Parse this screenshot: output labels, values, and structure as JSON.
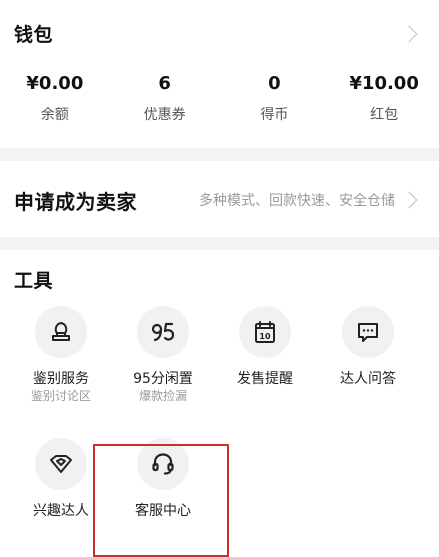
{
  "wallet": {
    "title": "钱包",
    "stats": [
      {
        "value": "¥0.00",
        "label": "余额"
      },
      {
        "value": "6",
        "label": "优惠券"
      },
      {
        "value": "0",
        "label": "得币"
      },
      {
        "value": "¥10.00",
        "label": "红包"
      }
    ]
  },
  "seller": {
    "title": "申请成为卖家",
    "description": "多种模式、回款快速、安全仓储"
  },
  "tools": {
    "title": "工具",
    "items": [
      {
        "label": "鉴别服务",
        "sub": "鉴别讨论区",
        "icon": "stamp-icon"
      },
      {
        "label": "95分闲置",
        "sub": "爆款捡漏",
        "icon": "95-logo-icon"
      },
      {
        "label": "发售提醒",
        "sub": "",
        "icon": "calendar-icon"
      },
      {
        "label": "达人问答",
        "sub": "",
        "icon": "chat-bubble-icon"
      },
      {
        "label": "兴趣达人",
        "sub": "",
        "icon": "diamond-icon"
      },
      {
        "label": "客服中心",
        "sub": "",
        "icon": "headset-icon"
      }
    ]
  },
  "colors": {
    "highlight_border": "#c9302c",
    "section_gap": "#f3f3f3",
    "icon_bg": "#f1f1f1"
  }
}
